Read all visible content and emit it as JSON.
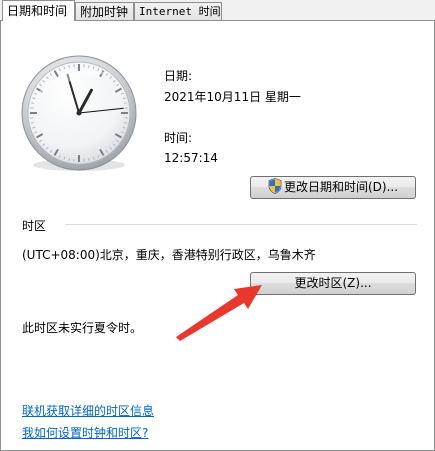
{
  "tabs": [
    {
      "label": "日期和时间"
    },
    {
      "label": "附加时钟"
    },
    {
      "label": "Internet 时间"
    }
  ],
  "date_section": {
    "date_label": "日期:",
    "date_value": "2021年10月11日 星期一",
    "time_label": "时间:",
    "time_value": "12:57:14"
  },
  "change_datetime_button": {
    "label": "更改日期和时间(D)..."
  },
  "timezone": {
    "section_label": "时区",
    "value": "(UTC+08:00)北京，重庆，香港特别行政区，乌鲁木齐",
    "change_button_label": "更改时区(Z)...",
    "dst_note": "此时区未实行夏令时。"
  },
  "links": {
    "online_info": "联机获取详细的时区信息",
    "how_to_set": "我如何设置时钟和时区?"
  },
  "colors": {
    "link": "#0066cc",
    "annotation_arrow": "#e8372c",
    "second_hand": "#111111"
  },
  "clock": {
    "hour": 12,
    "minute": 57,
    "second": 14
  }
}
